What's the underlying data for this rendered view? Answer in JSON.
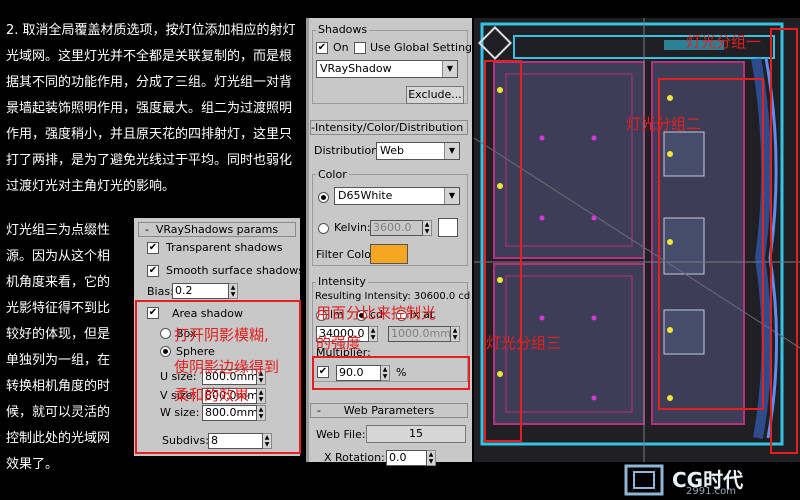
{
  "article": {
    "para1": "2. 取消全局覆盖材质选项，按灯位添加相应的射灯光域网。这里灯光并不全都是关联复制的，而是根据其不同的功能作用，分成了三组。灯光组一对背景墙起装饰照明作用，强度最大。组二为过渡照明作用，强度稍小，并且原天花的四排射灯，这里只打了两排，是为了避免光线过于平均。同时也弱化过渡灯光对主角灯光的影响。",
    "para2_top": "灯光组三为点缀性",
    "para2_rest": "源。因为从这个相机角度来看，它的光影特征得不到比较好的体现，但是单独列为一组，在转换相机角度的时候，就可以灵活的控制此处的光域网效果了。"
  },
  "shadows_rollout": {
    "group_title": "Shadows",
    "on_label": "On",
    "on_checked": true,
    "global_label": "Use Global Settings",
    "global_checked": false,
    "shadow_type": "VRayShadow",
    "exclude_button": "Exclude..."
  },
  "intensity_rollout": {
    "title": "Intensity/Color/Distribution",
    "distribution_label": "Distribution:",
    "distribution_value": "Web",
    "color_group": "Color",
    "color_preset": "D65White",
    "kelvin_label": "Kelvin:",
    "kelvin_value": "3600.0",
    "filter_color_label": "Filter Color:",
    "filter_color": "#f5a623",
    "intensity_group": "Intensity",
    "resulting_intensity": "Resulting Intensity: 30600.0 cd",
    "lm_label": "lm",
    "cd_label": "cd",
    "lx_label": "lx at",
    "intensity_value": "34000.0",
    "distance_value": "1000.0mm",
    "multiplier_label": "Multiplier:",
    "multiplier_checked": true,
    "multiplier_value": "90.0",
    "percent": "%"
  },
  "web_rollout": {
    "title": "Web Parameters",
    "web_file_label": "Web File:",
    "web_file_value": "15",
    "x_rotation_label": "X Rotation:",
    "x_rotation_value": "0.0"
  },
  "vray_shadow_params": {
    "title": "VRayShadows params",
    "transparent_label": "Transparent shadows",
    "transparent_checked": true,
    "smooth_label": "Smooth surface shadows",
    "smooth_checked": true,
    "bias_label": "Bias:",
    "bias_value": "0.2",
    "area_label": "Area shadow",
    "area_checked": true,
    "box_label": "Box",
    "sphere_label": "Sphere",
    "u_label": "U size:",
    "u_value": "800.0mm",
    "v_label": "V size:",
    "v_value": "800.0mm",
    "w_label": "W size:",
    "w_value": "800.0mm",
    "subdivs_label": "Subdivs:",
    "subdivs_value": "8"
  },
  "annotations": {
    "group1": "灯光分组一",
    "group2": "灯光分组二",
    "group3": "灯光分组三",
    "percent_note_line1": "用百分比来控制光",
    "percent_note_line2": "的强度",
    "area_note_line1": "打开阴影模糊,",
    "area_note_line2": "使阴影边缘得到",
    "area_note_line3": "柔和的效果",
    "color": "#e22020"
  },
  "watermark": {
    "logo_text": "CG时代",
    "site": "2991.com"
  }
}
